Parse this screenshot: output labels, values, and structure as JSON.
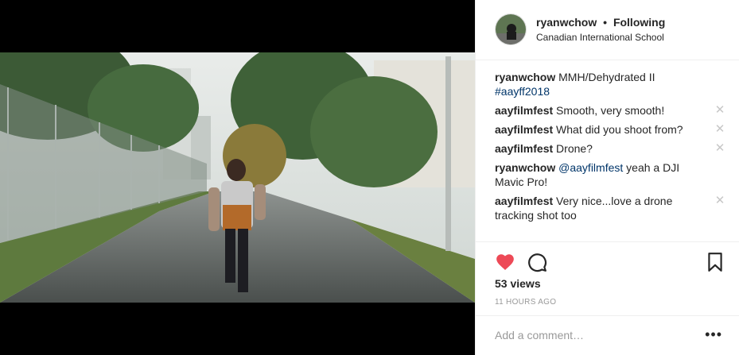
{
  "header": {
    "username": "ryanwchow",
    "separator": "•",
    "follow_status": "Following",
    "location": "Canadian International School"
  },
  "caption": {
    "username": "ryanwchow",
    "text": "MMH/Dehydrated II ",
    "hashtag": "#aayff2018"
  },
  "comments": [
    {
      "username": "aayfilmfest",
      "text": "Smooth, very smooth!"
    },
    {
      "username": "aayfilmfest",
      "text": "What did you shoot from?"
    },
    {
      "username": "aayfilmfest",
      "text": "Drone?"
    },
    {
      "username": "ryanwchow",
      "mention": "@aayfilmfest",
      "text": " yeah a DJI Mavic Pro!"
    },
    {
      "username": "aayfilmfest",
      "text": "Very nice...love a drone tracking shot too"
    }
  ],
  "delete_glyph": "✕",
  "actions": {
    "views": "53 views",
    "timestamp": "11 HOURS AGO",
    "like_color": "#ed4956"
  },
  "add_comment": {
    "placeholder": "Add a comment…",
    "more": "•••"
  }
}
